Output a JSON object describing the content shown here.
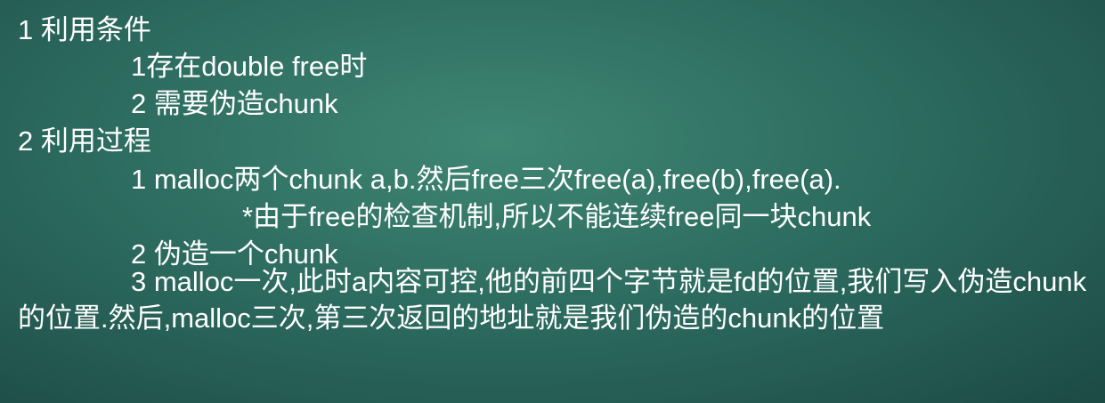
{
  "slide": {
    "lines": [
      "1 利用条件",
      "1存在double free时",
      "2 需要伪造chunk",
      "2 利用过程",
      "1 malloc两个chunk a,b.然后free三次free(a),free(b),free(a).",
      "*由于free的检查机制,所以不能连续free同一块chunk",
      "2 伪造一个chunk"
    ],
    "paragraph": "3 malloc一次,此时a内容可控,他的前四个字节就是fd的位置,我们写入伪造chunk的位置.然后,malloc三次,第三次返回的地址就是我们伪造的chunk的位置"
  }
}
